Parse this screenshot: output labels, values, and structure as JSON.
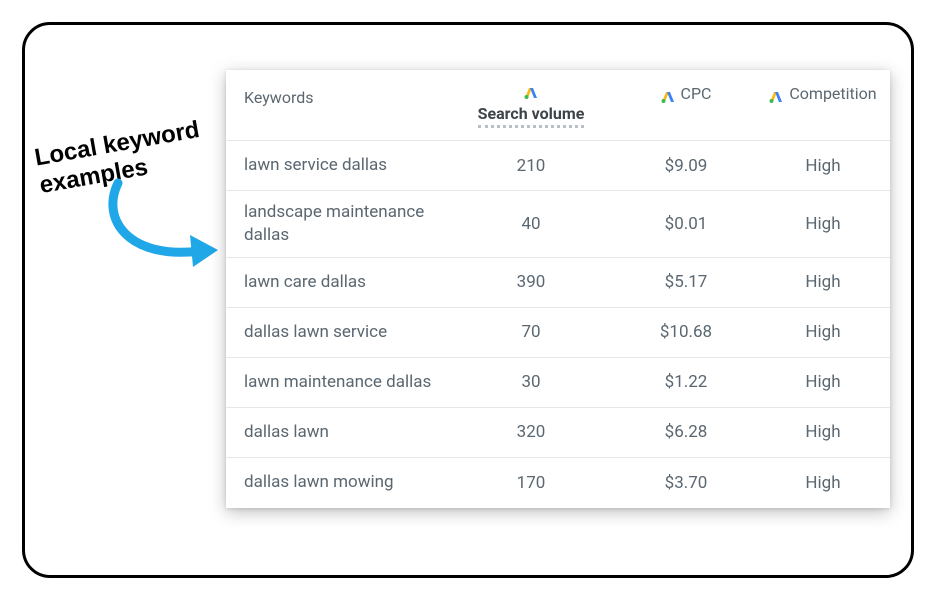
{
  "annotation": {
    "label": "Local keyword examples"
  },
  "table": {
    "headers": {
      "keywords": "Keywords",
      "search_volume": "Search volume",
      "cpc": "CPC",
      "competition": "Competition"
    },
    "rows": [
      {
        "keyword": "lawn service dallas",
        "search_volume": "210",
        "cpc": "$9.09",
        "competition": "High"
      },
      {
        "keyword": "landscape maintenance dallas",
        "search_volume": "40",
        "cpc": "$0.01",
        "competition": "High"
      },
      {
        "keyword": "lawn care dallas",
        "search_volume": "390",
        "cpc": "$5.17",
        "competition": "High"
      },
      {
        "keyword": "dallas lawn service",
        "search_volume": "70",
        "cpc": "$10.68",
        "competition": "High"
      },
      {
        "keyword": "lawn maintenance dallas",
        "search_volume": "30",
        "cpc": "$1.22",
        "competition": "High"
      },
      {
        "keyword": "dallas lawn",
        "search_volume": "320",
        "cpc": "$6.28",
        "competition": "High"
      },
      {
        "keyword": "dallas lawn mowing",
        "search_volume": "170",
        "cpc": "$3.70",
        "competition": "High"
      }
    ]
  },
  "chart_data": {
    "type": "table",
    "columns": [
      "Keywords",
      "Search volume",
      "CPC",
      "Competition"
    ],
    "rows": [
      [
        "lawn service dallas",
        210,
        9.09,
        "High"
      ],
      [
        "landscape maintenance dallas",
        40,
        0.01,
        "High"
      ],
      [
        "lawn care dallas",
        390,
        5.17,
        "High"
      ],
      [
        "dallas lawn service",
        70,
        10.68,
        "High"
      ],
      [
        "lawn maintenance dallas",
        30,
        1.22,
        "High"
      ],
      [
        "dallas lawn",
        320,
        6.28,
        "High"
      ],
      [
        "dallas lawn mowing",
        170,
        3.7,
        "High"
      ]
    ]
  }
}
